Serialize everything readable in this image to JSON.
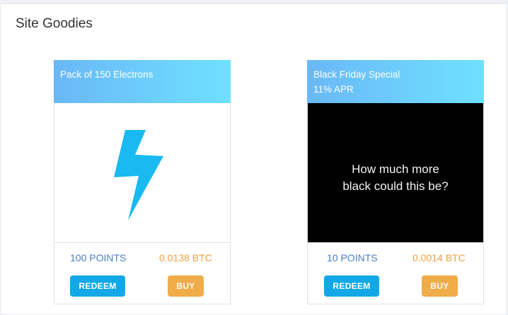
{
  "panel": {
    "title": "Site Goodies"
  },
  "cards": [
    {
      "header_lines": [
        "Pack of 150 Electrons"
      ],
      "image_icon": "lightning-bolt-icon",
      "points": "100 POINTS",
      "price": "0.0138 BTC",
      "redeem_label": "REDEEM",
      "buy_label": "BUY"
    },
    {
      "header_lines": [
        "Black Friday Special",
        "11% APR"
      ],
      "image_text_lines": [
        "How much more",
        "black could this be?"
      ],
      "points": "10 POINTS",
      "price": "0.0014 BTC",
      "redeem_label": "REDEEM",
      "buy_label": "BUY"
    }
  ],
  "colors": {
    "header_gradient_start": "#6ab8f7",
    "header_gradient_end": "#6fe0ff",
    "bolt": "#19b9f2",
    "points_text": "#4a7fc1",
    "price_text": "#f0a040",
    "redeem_button": "#12a8e8",
    "buy_button": "#f0ac48"
  }
}
